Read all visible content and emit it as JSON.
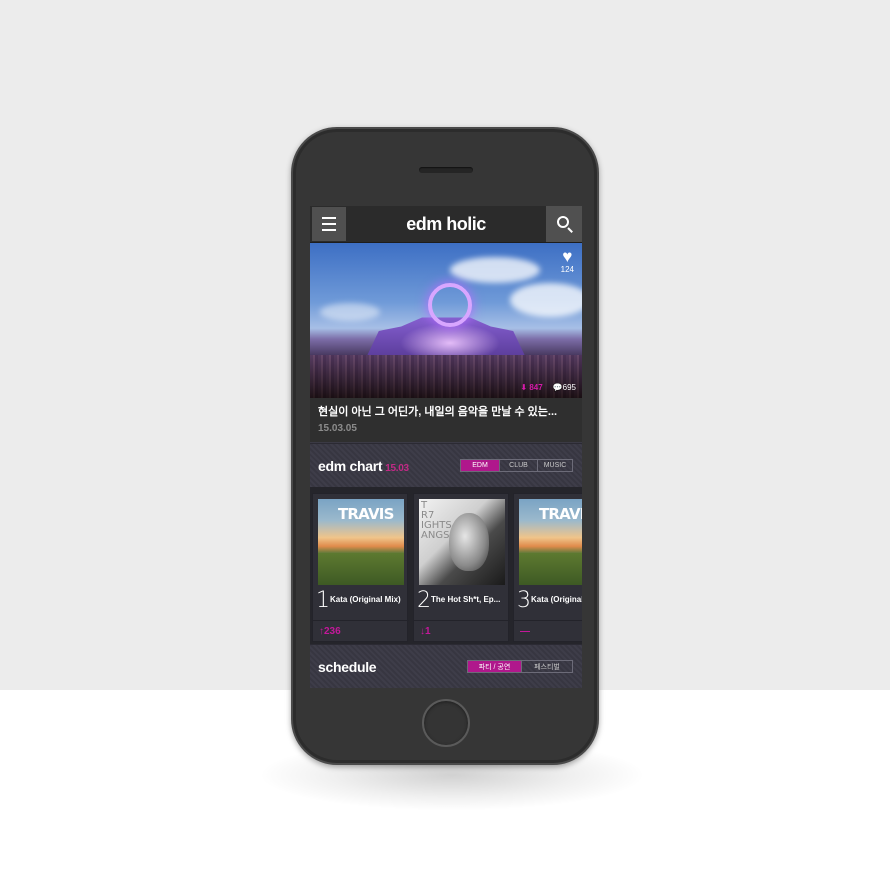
{
  "app": {
    "title": "edm holic"
  },
  "hero": {
    "likes": "124",
    "downloads": "847",
    "comments": "695",
    "title": "현실이 아닌 그 어딘가, 내일의 음악을 만날 수 있는...",
    "date": "15.03.05"
  },
  "chart": {
    "title": "edm chart",
    "date": "15.03",
    "tabs": [
      "EDM",
      "CLUB",
      "MUSIC"
    ],
    "active_tab": 0,
    "items": [
      {
        "rank": "1",
        "song": "Kata (Original Mix)",
        "change": "↑236",
        "art": "TRAVIS"
      },
      {
        "rank": "2",
        "song": "The Hot Sh*t, Ep...",
        "change": "↓1",
        "art": "bw"
      },
      {
        "rank": "3",
        "song": "Kata (Original Mix)",
        "change": "—",
        "art": "TRAVIS"
      }
    ]
  },
  "schedule": {
    "title": "schedule",
    "tabs": [
      "파티 / 공연",
      "페스티벌"
    ],
    "active_tab": 0
  },
  "colors": {
    "accent": "#b0188c",
    "header": "#2b2b2b",
    "panel": "#3b3a45"
  }
}
